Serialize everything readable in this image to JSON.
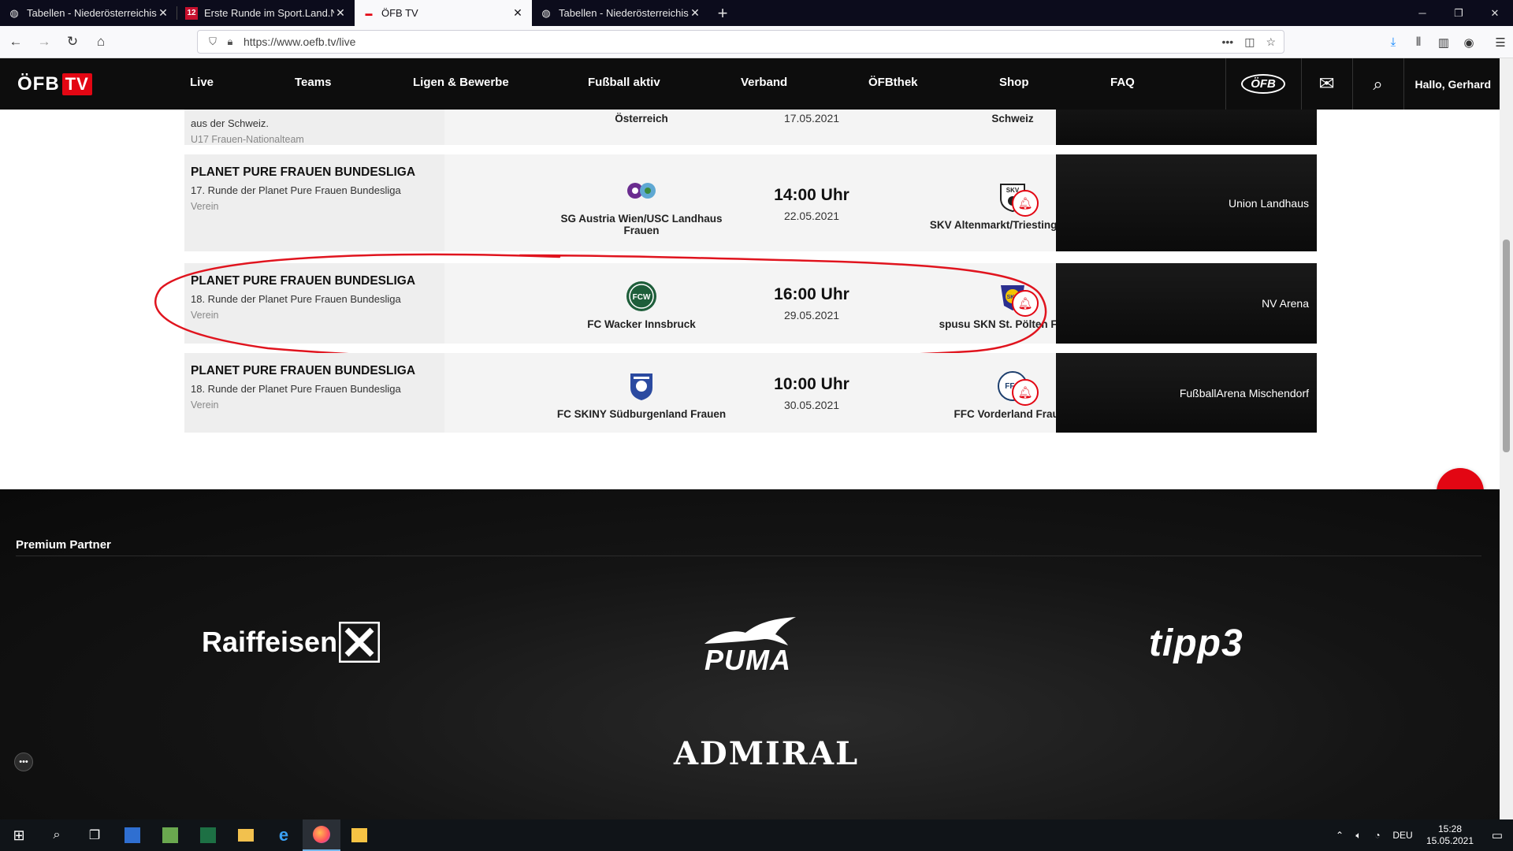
{
  "browser": {
    "tabs": [
      {
        "title": "Tabellen - Niederösterreichische",
        "icon": "globe-icon",
        "active": false
      },
      {
        "title": "Erste Runde im Sport.Land.NÖ",
        "icon": "news-icon",
        "active": false
      },
      {
        "title": "ÖFB TV",
        "icon": "oefb-icon",
        "active": true
      },
      {
        "title": "Tabellen - Niederösterreichische",
        "icon": "globe-icon",
        "active": false
      }
    ],
    "new_tab": "+",
    "url": "https://www.oefb.tv/live"
  },
  "site": {
    "logo_text": "ÖFB",
    "logo_tv": "TV",
    "nav": [
      "Live",
      "Teams",
      "Ligen & Bewerbe",
      "Fußball aktiv",
      "Verband",
      "ÖFBthek",
      "Shop",
      "FAQ"
    ],
    "oefb_badge": "ÖFB",
    "greeting": "Hallo, Gerhard",
    "accent": "#e30613"
  },
  "matches": [
    {
      "league": "",
      "round": "aus der Schweiz.",
      "kind": "U17 Frauen-Nationalteam",
      "home": "Österreich",
      "time": "",
      "date": "17.05.2021",
      "away": "Schweiz",
      "venue": ""
    },
    {
      "league": "PLANET PURE FRAUEN BUNDESLIGA",
      "round": "17. Runde der Planet Pure Frauen Bundesliga",
      "kind": "Verein",
      "home": "SG Austria Wien/USC Landhaus Frauen",
      "time": "14:00 Uhr",
      "date": "22.05.2021",
      "away": "SKV Altenmarkt/Triesting Frauen",
      "venue": "Union Landhaus"
    },
    {
      "league": "PLANET PURE FRAUEN BUNDESLIGA",
      "round": "18. Runde der Planet Pure Frauen Bundesliga",
      "kind": "Verein",
      "home": "FC Wacker Innsbruck",
      "time": "16:00 Uhr",
      "date": "29.05.2021",
      "away": "spusu SKN St. Pölten Frauen",
      "venue": "NV Arena"
    },
    {
      "league": "PLANET PURE FRAUEN BUNDESLIGA",
      "round": "18. Runde der Planet Pure Frauen Bundesliga",
      "kind": "Verein",
      "home": "FC SKINY Südburgenland Frauen",
      "time": "10:00 Uhr",
      "date": "30.05.2021",
      "away": "FFC Vorderland Frauen",
      "venue": "FußballArena Mischendorf"
    }
  ],
  "crests": {
    "skv": "SKV",
    "wacker": "FCW",
    "skn": "SKN",
    "ffc": "FFC"
  },
  "partners": {
    "title": "Premium Partner",
    "logos": [
      "Raiffeisen",
      "PUMA",
      "tipp3",
      "ADMIRAL"
    ]
  },
  "taskbar": {
    "lang": "DEU",
    "time": "15:28",
    "date": "15.05.2021"
  }
}
